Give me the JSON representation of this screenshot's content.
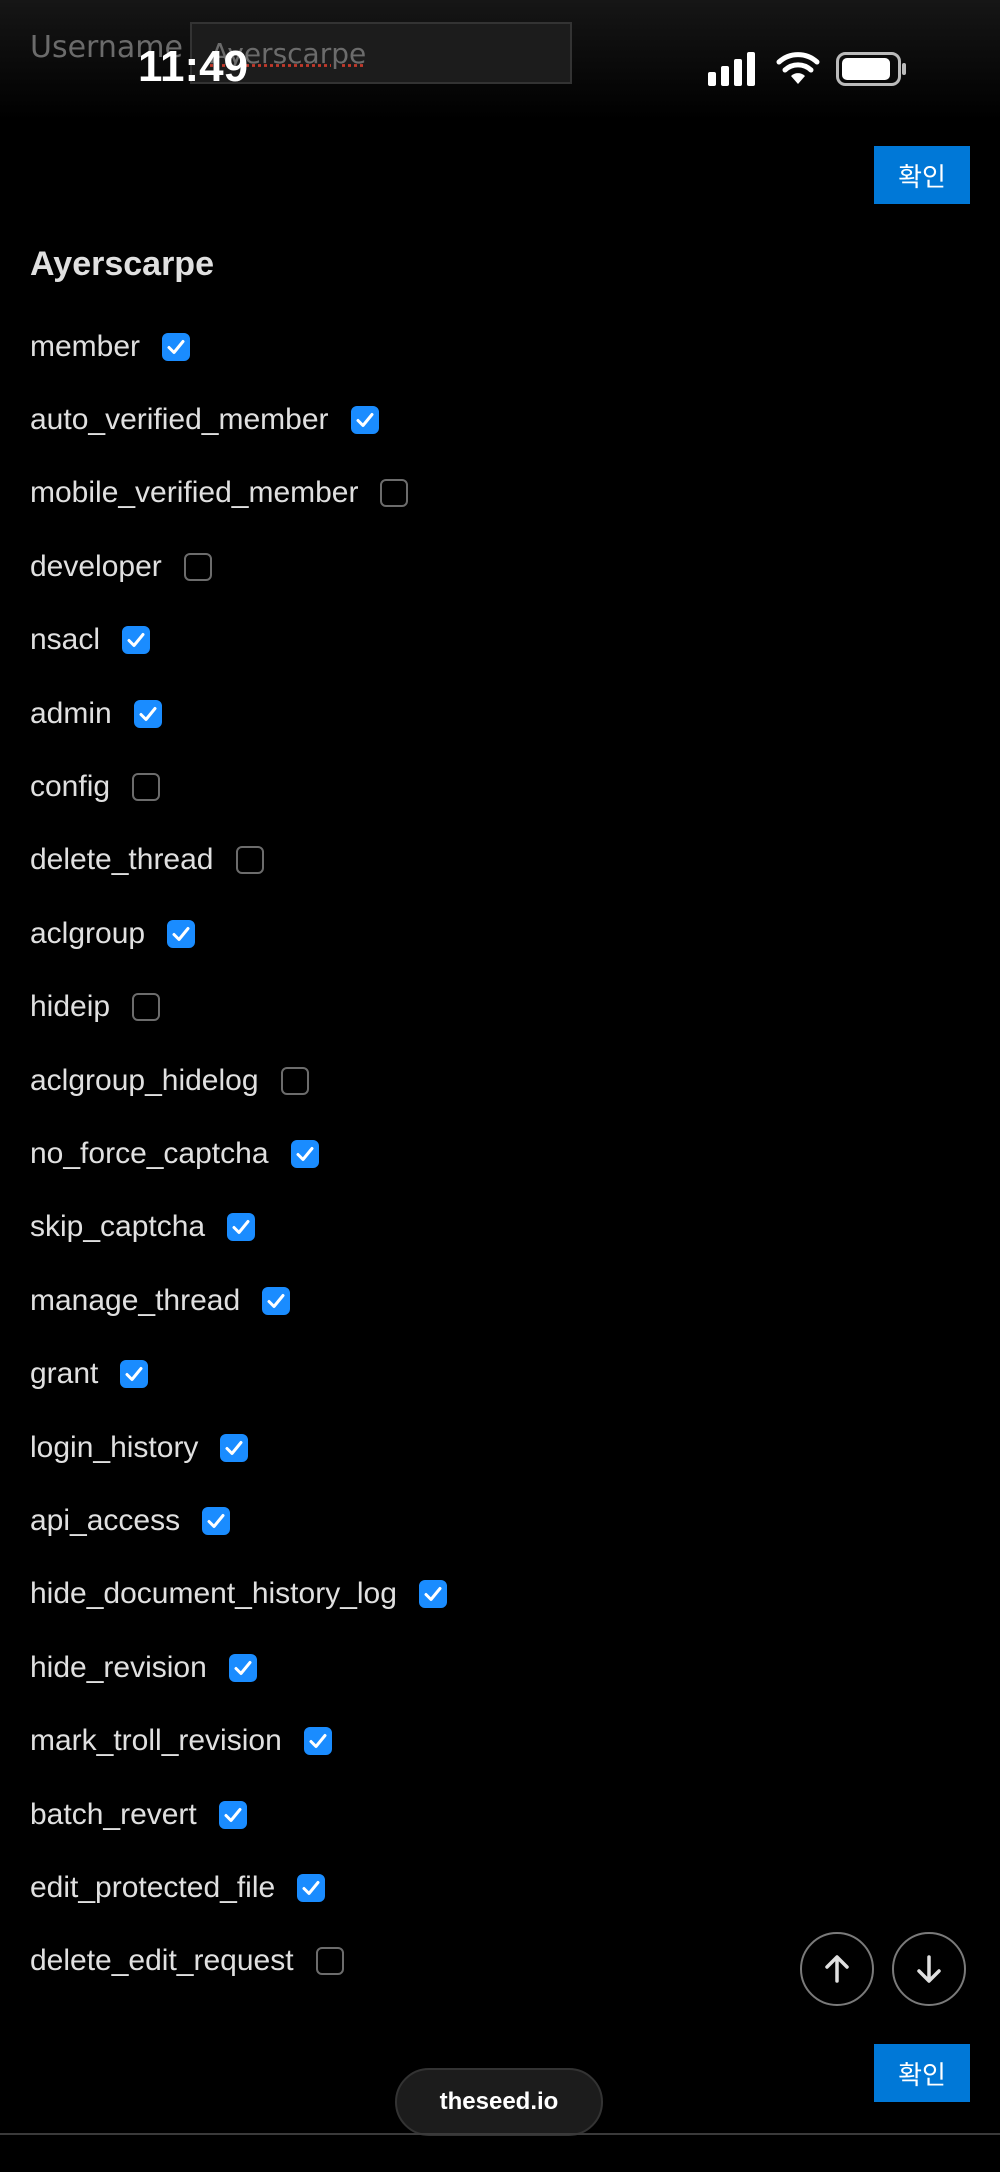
{
  "status_bar": {
    "time": "11:49"
  },
  "form": {
    "username_label": "Username",
    "username_value": "Ayerscarpe",
    "confirm_label": "확인"
  },
  "group_title": "Ayerscarpe",
  "permissions": [
    {
      "label": "member",
      "checked": true
    },
    {
      "label": "auto_verified_member",
      "checked": true
    },
    {
      "label": "mobile_verified_member",
      "checked": false
    },
    {
      "label": "developer",
      "checked": false
    },
    {
      "label": "nsacl",
      "checked": true
    },
    {
      "label": "admin",
      "checked": true
    },
    {
      "label": "config",
      "checked": false
    },
    {
      "label": "delete_thread",
      "checked": false
    },
    {
      "label": "aclgroup",
      "checked": true
    },
    {
      "label": "hideip",
      "checked": false
    },
    {
      "label": "aclgroup_hidelog",
      "checked": false
    },
    {
      "label": "no_force_captcha",
      "checked": true
    },
    {
      "label": "skip_captcha",
      "checked": true
    },
    {
      "label": "manage_thread",
      "checked": true
    },
    {
      "label": "grant",
      "checked": true
    },
    {
      "label": "login_history",
      "checked": true
    },
    {
      "label": "api_access",
      "checked": true
    },
    {
      "label": "hide_document_history_log",
      "checked": true
    },
    {
      "label": "hide_revision",
      "checked": true
    },
    {
      "label": "mark_troll_revision",
      "checked": true
    },
    {
      "label": "batch_revert",
      "checked": true
    },
    {
      "label": "edit_protected_file",
      "checked": true
    },
    {
      "label": "delete_edit_request",
      "checked": false
    }
  ],
  "browser": {
    "domain": "theseed.io"
  },
  "colors": {
    "accent": "#1a8cff",
    "button": "#0078d7",
    "background": "#000000"
  }
}
